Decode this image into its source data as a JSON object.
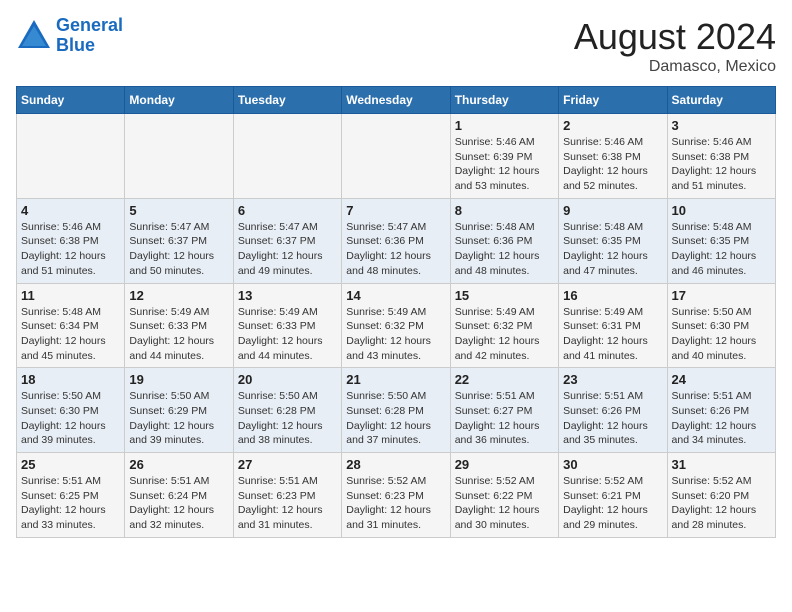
{
  "header": {
    "logo_line1": "General",
    "logo_line2": "Blue",
    "title": "August 2024",
    "subtitle": "Damasco, Mexico"
  },
  "calendar": {
    "days_of_week": [
      "Sunday",
      "Monday",
      "Tuesday",
      "Wednesday",
      "Thursday",
      "Friday",
      "Saturday"
    ],
    "weeks": [
      [
        {
          "day": "",
          "info": ""
        },
        {
          "day": "",
          "info": ""
        },
        {
          "day": "",
          "info": ""
        },
        {
          "day": "",
          "info": ""
        },
        {
          "day": "1",
          "info": "Sunrise: 5:46 AM\nSunset: 6:39 PM\nDaylight: 12 hours\nand 53 minutes."
        },
        {
          "day": "2",
          "info": "Sunrise: 5:46 AM\nSunset: 6:38 PM\nDaylight: 12 hours\nand 52 minutes."
        },
        {
          "day": "3",
          "info": "Sunrise: 5:46 AM\nSunset: 6:38 PM\nDaylight: 12 hours\nand 51 minutes."
        }
      ],
      [
        {
          "day": "4",
          "info": "Sunrise: 5:46 AM\nSunset: 6:38 PM\nDaylight: 12 hours\nand 51 minutes."
        },
        {
          "day": "5",
          "info": "Sunrise: 5:47 AM\nSunset: 6:37 PM\nDaylight: 12 hours\nand 50 minutes."
        },
        {
          "day": "6",
          "info": "Sunrise: 5:47 AM\nSunset: 6:37 PM\nDaylight: 12 hours\nand 49 minutes."
        },
        {
          "day": "7",
          "info": "Sunrise: 5:47 AM\nSunset: 6:36 PM\nDaylight: 12 hours\nand 48 minutes."
        },
        {
          "day": "8",
          "info": "Sunrise: 5:48 AM\nSunset: 6:36 PM\nDaylight: 12 hours\nand 48 minutes."
        },
        {
          "day": "9",
          "info": "Sunrise: 5:48 AM\nSunset: 6:35 PM\nDaylight: 12 hours\nand 47 minutes."
        },
        {
          "day": "10",
          "info": "Sunrise: 5:48 AM\nSunset: 6:35 PM\nDaylight: 12 hours\nand 46 minutes."
        }
      ],
      [
        {
          "day": "11",
          "info": "Sunrise: 5:48 AM\nSunset: 6:34 PM\nDaylight: 12 hours\nand 45 minutes."
        },
        {
          "day": "12",
          "info": "Sunrise: 5:49 AM\nSunset: 6:33 PM\nDaylight: 12 hours\nand 44 minutes."
        },
        {
          "day": "13",
          "info": "Sunrise: 5:49 AM\nSunset: 6:33 PM\nDaylight: 12 hours\nand 44 minutes."
        },
        {
          "day": "14",
          "info": "Sunrise: 5:49 AM\nSunset: 6:32 PM\nDaylight: 12 hours\nand 43 minutes."
        },
        {
          "day": "15",
          "info": "Sunrise: 5:49 AM\nSunset: 6:32 PM\nDaylight: 12 hours\nand 42 minutes."
        },
        {
          "day": "16",
          "info": "Sunrise: 5:49 AM\nSunset: 6:31 PM\nDaylight: 12 hours\nand 41 minutes."
        },
        {
          "day": "17",
          "info": "Sunrise: 5:50 AM\nSunset: 6:30 PM\nDaylight: 12 hours\nand 40 minutes."
        }
      ],
      [
        {
          "day": "18",
          "info": "Sunrise: 5:50 AM\nSunset: 6:30 PM\nDaylight: 12 hours\nand 39 minutes."
        },
        {
          "day": "19",
          "info": "Sunrise: 5:50 AM\nSunset: 6:29 PM\nDaylight: 12 hours\nand 39 minutes."
        },
        {
          "day": "20",
          "info": "Sunrise: 5:50 AM\nSunset: 6:28 PM\nDaylight: 12 hours\nand 38 minutes."
        },
        {
          "day": "21",
          "info": "Sunrise: 5:50 AM\nSunset: 6:28 PM\nDaylight: 12 hours\nand 37 minutes."
        },
        {
          "day": "22",
          "info": "Sunrise: 5:51 AM\nSunset: 6:27 PM\nDaylight: 12 hours\nand 36 minutes."
        },
        {
          "day": "23",
          "info": "Sunrise: 5:51 AM\nSunset: 6:26 PM\nDaylight: 12 hours\nand 35 minutes."
        },
        {
          "day": "24",
          "info": "Sunrise: 5:51 AM\nSunset: 6:26 PM\nDaylight: 12 hours\nand 34 minutes."
        }
      ],
      [
        {
          "day": "25",
          "info": "Sunrise: 5:51 AM\nSunset: 6:25 PM\nDaylight: 12 hours\nand 33 minutes."
        },
        {
          "day": "26",
          "info": "Sunrise: 5:51 AM\nSunset: 6:24 PM\nDaylight: 12 hours\nand 32 minutes."
        },
        {
          "day": "27",
          "info": "Sunrise: 5:51 AM\nSunset: 6:23 PM\nDaylight: 12 hours\nand 31 minutes."
        },
        {
          "day": "28",
          "info": "Sunrise: 5:52 AM\nSunset: 6:23 PM\nDaylight: 12 hours\nand 31 minutes."
        },
        {
          "day": "29",
          "info": "Sunrise: 5:52 AM\nSunset: 6:22 PM\nDaylight: 12 hours\nand 30 minutes."
        },
        {
          "day": "30",
          "info": "Sunrise: 5:52 AM\nSunset: 6:21 PM\nDaylight: 12 hours\nand 29 minutes."
        },
        {
          "day": "31",
          "info": "Sunrise: 5:52 AM\nSunset: 6:20 PM\nDaylight: 12 hours\nand 28 minutes."
        }
      ]
    ]
  }
}
